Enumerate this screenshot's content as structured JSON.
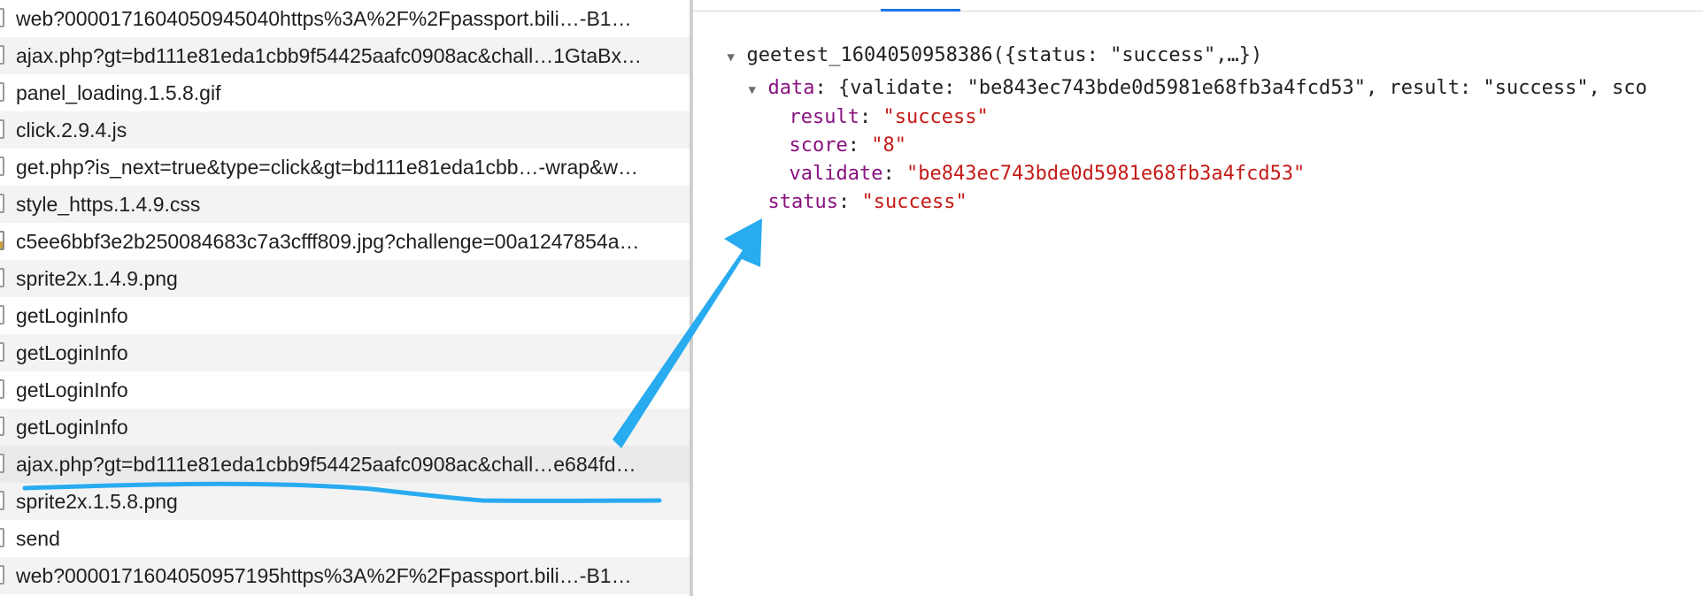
{
  "requests": [
    {
      "name": "web?000017160405094504​0https%3A%2F%2Fpassport.bili…-B1…",
      "icon": "file-icon"
    },
    {
      "name": "ajax.php?gt=bd111e81eda1cbb9f54425aafc0908ac&chall…1GtaBx…",
      "icon": "file-icon"
    },
    {
      "name": "panel_loading.1.5.8.gif",
      "icon": "file-icon"
    },
    {
      "name": "click.2.9.4.js",
      "icon": "file-icon"
    },
    {
      "name": "get.php?is_next=true&type=click&gt=bd111e81eda1cbb…-wrap&w…",
      "icon": "file-icon"
    },
    {
      "name": "style_https.1.4.9.css",
      "icon": "file-icon"
    },
    {
      "name": "c5ee6bbf3e2b250084683c7a3cfff809.jpg?challenge=00a1247854a…",
      "icon": "image-icon"
    },
    {
      "name": "sprite2x.1.4.9.png",
      "icon": "file-icon"
    },
    {
      "name": "getLoginInfo",
      "icon": "file-icon"
    },
    {
      "name": "getLoginInfo",
      "icon": "file-icon"
    },
    {
      "name": "getLoginInfo",
      "icon": "file-icon"
    },
    {
      "name": "getLoginInfo",
      "icon": "file-icon"
    },
    {
      "name": "ajax.php?gt=bd111e81eda1cbb9f54425aafc0908ac&chall…e684fd…",
      "icon": "file-icon",
      "selected": true
    },
    {
      "name": "sprite2x.1.5.8.png",
      "icon": "file-icon"
    },
    {
      "name": "send",
      "icon": "file-icon"
    },
    {
      "name": "web?000017160405095719​5https%3A%2F%2Fpassport.bili…-B1…",
      "icon": "file-icon"
    }
  ],
  "preview": {
    "root_label": "geetest_1604050958386({status: \"success\",…})",
    "data_key": "data",
    "data_summary": ": {validate: \"be843ec743bde0d5981e68fb3a4fcd53\", result: \"success\", sco",
    "fields": [
      {
        "key": "result",
        "value": "\"success\""
      },
      {
        "key": "score",
        "value": "\"8\""
      },
      {
        "key": "validate",
        "value": "\"be843ec743bde0d5981e68fb3a4fcd53\""
      }
    ],
    "status_key": "status",
    "status_value": "\"success\""
  },
  "colors": {
    "annotation_blue": "#29abf0",
    "json_key": "#881280",
    "json_string": "#c41a16"
  }
}
